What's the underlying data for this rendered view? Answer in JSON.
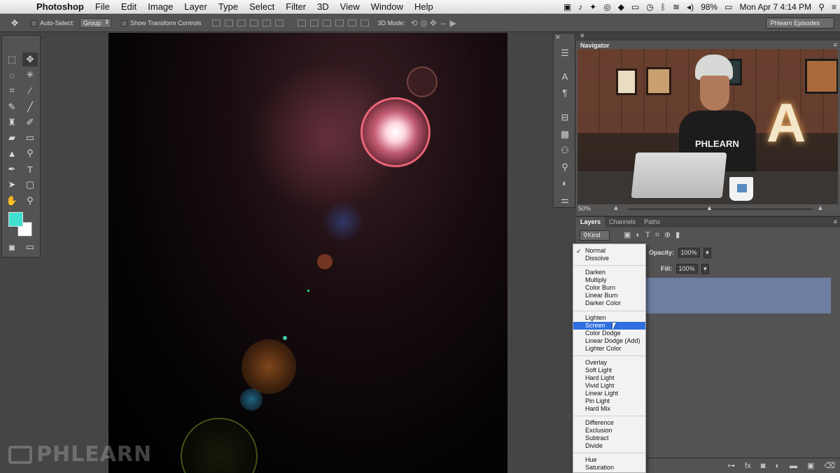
{
  "menubar": {
    "items": [
      "Photoshop",
      "File",
      "Edit",
      "Image",
      "Layer",
      "Type",
      "Select",
      "Filter",
      "3D",
      "View",
      "Window",
      "Help"
    ],
    "battery": "98%",
    "datetime": "Mon Apr 7  4:14 PM"
  },
  "options": {
    "auto_select_label": "Auto-Select:",
    "auto_select_value": "Group",
    "show_transform_label": "Show Transform Controls",
    "mode_3d_label": "3D Mode:",
    "workspace": "Phlearn Episodes"
  },
  "navigator": {
    "tab": "Navigator",
    "zoom": "50%"
  },
  "layers": {
    "tabs": [
      "Layers",
      "Channels",
      "Paths"
    ],
    "kind_label": "Kind",
    "opacity_label": "Opacity:",
    "opacity_value": "100%",
    "fill_label": "Fill:",
    "fill_value": "100%"
  },
  "blend_modes": {
    "items": [
      "Normal",
      "Dissolve",
      "Darken",
      "Multiply",
      "Color Burn",
      "Linear Burn",
      "Darker Color",
      "Lighten",
      "Screen",
      "Color Dodge",
      "Linear Dodge (Add)",
      "Lighter Color",
      "Overlay",
      "Soft Light",
      "Hard Light",
      "Vivid Light",
      "Linear Light",
      "Pin Light",
      "Hard Mix",
      "Difference",
      "Exclusion",
      "Subtract",
      "Divide",
      "Hue",
      "Saturation"
    ],
    "checked": "Normal",
    "highlighted": "Screen",
    "check_mark": "✓"
  },
  "video": {
    "shirt_text": "PHLEARN",
    "marquee_letter": "A"
  },
  "watermark": "PHLEARN",
  "colors": {
    "foreground": "#40e0d0",
    "background": "#ffffff",
    "selection": "#2f6fe0",
    "layer_selected": "#6d7ea1"
  }
}
